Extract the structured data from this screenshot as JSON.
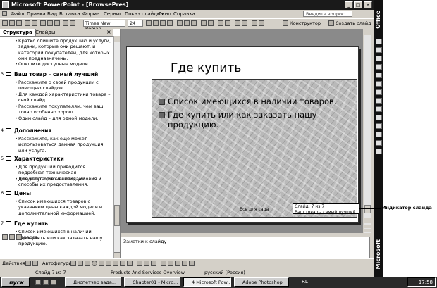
{
  "window": {
    "title": "Microsoft PowerPoint - [BrowsePres]",
    "min": "_",
    "max": "□",
    "close": "✕"
  },
  "menu": {
    "items": [
      "Файл",
      "Правка",
      "Вид",
      "Вставка",
      "Формат",
      "Сервис",
      "Показ слайдов",
      "Окно",
      "Справка"
    ],
    "help_placeholder": "Введите вопрос"
  },
  "toolbar": {
    "font": "Times New Roman",
    "size": "24",
    "designer": "Конструктор",
    "new_slide": "Создать слайд"
  },
  "outline": {
    "tab_structure": "Структура",
    "tab_slides": "Слайды",
    "top_bullets": [
      "Кратко опишите продукцию и услуги, задачи, которые они решают, и категории покупателей, для которых они предназначены.",
      "Опишите доступные модели."
    ],
    "slides": [
      {
        "num": "3",
        "title": "Ваш товар – самый лучший",
        "bullets": [
          "Расскажите о своей продукции с помощью слайдов.",
          "Для каждой характеристики товара – свой слайд.",
          "Расскажите покупателям, чем ваш товар особенно хорош.",
          "Один слайд – для одной модели."
        ]
      },
      {
        "num": "4",
        "title": "Дополнения",
        "bullets": [
          "Расскажите, как еще может использоваться данная продукция или услуга."
        ]
      },
      {
        "num": "5",
        "title": "Характеристики",
        "bullets": [
          "Для продукции приводится подробная техническая документация со слайдами.",
          "Для услуг описываются условия и способы их предоставления."
        ]
      },
      {
        "num": "6",
        "title": "Цены",
        "bullets": [
          "Список имеющихся товаров с указанием цены каждой модели и дополнительной информацией."
        ]
      },
      {
        "num": "7",
        "title": "Где купить",
        "bullets": [
          "Список имеющихся в наличии товаров.",
          "Где купить или как заказать нашу продукцию."
        ]
      }
    ]
  },
  "slide": {
    "title": "Где купить",
    "bullets": [
      "Список имеющихся в наличии товаров.",
      "Где купить или как заказать нашу продукцию."
    ],
    "footer": "Все для сада"
  },
  "tooltip": {
    "line1": "Слайд: 7 из 7",
    "line2": "Ваш товар – самый лучший"
  },
  "callout": "Индикатор слайда",
  "notes_placeholder": "Заметки к слайду",
  "drawing": {
    "actions": "Действия",
    "autoshapes": "Автофигуры"
  },
  "status": {
    "slide": "Слайд 7 из 7",
    "design": "Products And Services Overview",
    "language": "русский (Россия)"
  },
  "office_bar": {
    "top": "Office",
    "bottom": "Microsoft"
  },
  "taskbar": {
    "start": "пуск",
    "buttons": [
      "Диспетчер зада...",
      "Chapter01 - Micro...",
      "4 Microsoft Pow...",
      "Adobe Photoshop"
    ],
    "lang": "RL",
    "clock": "17:58"
  }
}
